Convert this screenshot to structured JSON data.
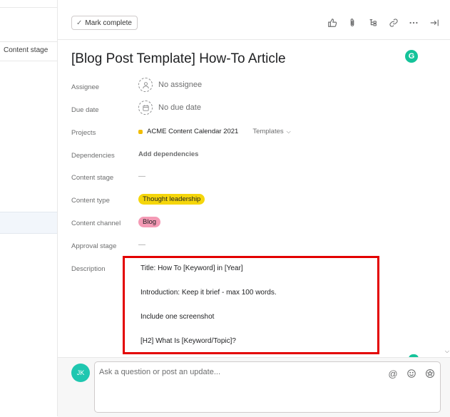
{
  "list": {
    "column_header": "Content stage"
  },
  "toolbar": {
    "mark_complete_label": "Mark complete",
    "icons": [
      "thumbs-up-icon",
      "attachment-icon",
      "subtasks-icon",
      "link-icon",
      "more-icon",
      "close-pane-icon"
    ]
  },
  "task": {
    "title": "[Blog Post Template] How-To Article",
    "grammarly_letter": "G"
  },
  "fields": {
    "assignee": {
      "label": "Assignee",
      "value": "No assignee"
    },
    "due_date": {
      "label": "Due date",
      "value": "No due date"
    },
    "projects": {
      "label": "Projects",
      "project": "ACME Content Calendar 2021",
      "section": "Templates"
    },
    "dependencies": {
      "label": "Dependencies",
      "value": "Add dependencies"
    },
    "content_stage": {
      "label": "Content stage",
      "value": "—"
    },
    "content_type": {
      "label": "Content type",
      "value": "Thought leadership"
    },
    "content_channel": {
      "label": "Content channel",
      "value": "Blog"
    },
    "approval_stage": {
      "label": "Approval stage",
      "value": "—"
    },
    "description": {
      "label": "Description",
      "lines": [
        "Title: How To [Keyword] in [Year]",
        "Introduction: Keep it brief - max 100 words.",
        "Include one screenshot",
        "[H2] What Is [Keyword/Topic]?"
      ]
    }
  },
  "comment": {
    "avatar_initials": "JK",
    "placeholder": "Ask a question or post an update...",
    "icons": [
      "mention-icon",
      "emoji-icon",
      "star-icon"
    ]
  },
  "colors": {
    "highlight_box": "#e30000",
    "project_color": "#f1bd00",
    "content_type_pill": "#f5d60b",
    "content_channel_pill": "#f49ab5",
    "avatar": "#1fc7b0",
    "grammarly": "#15c39a"
  }
}
